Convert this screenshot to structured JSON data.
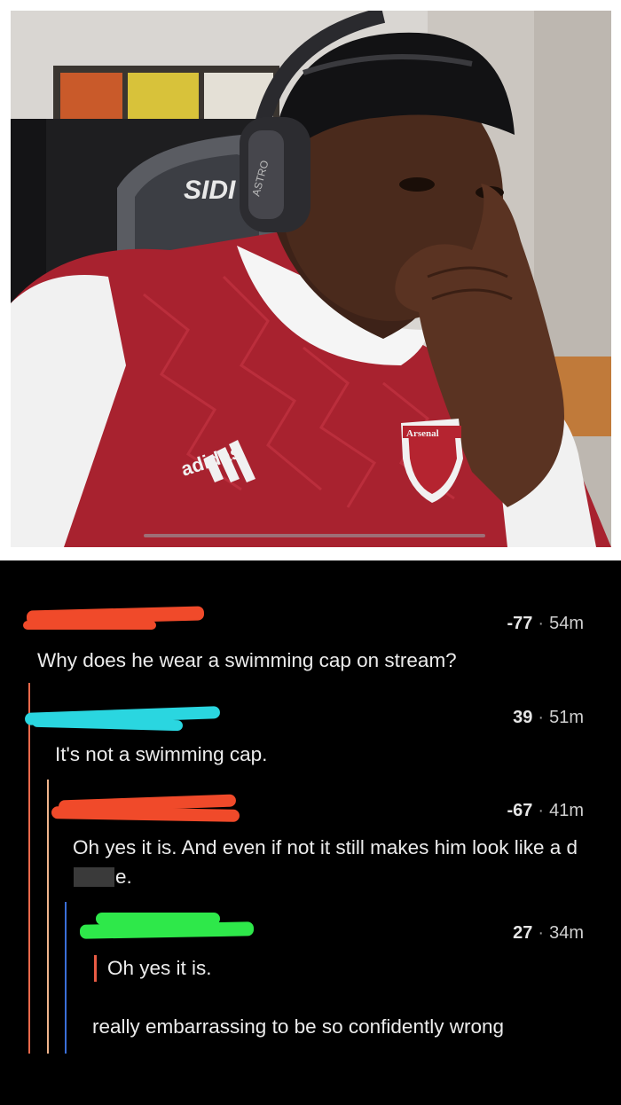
{
  "photo": {
    "shirt_brand": "adidas",
    "shirt_club": "Arsenal",
    "chair_brand": "SIDI",
    "headset_brand": "ASTRO"
  },
  "comments": [
    {
      "score": "-77",
      "age": "54m",
      "text": "Why does he wear a swimming cap on stream?",
      "username_redaction_color": "#f04a2a"
    },
    {
      "score": "39",
      "age": "51m",
      "text": "It's not a swimming cap.",
      "username_redaction_color": "#2ad6e0"
    },
    {
      "score": "-67",
      "age": "41m",
      "text_part1": "Oh yes it is. And even if not it still makes him look like a d",
      "text_part2": "e.",
      "username_redaction_color": "#f04a2a"
    },
    {
      "score": "27",
      "age": "34m",
      "quote": "Oh yes it is.",
      "text": "really embarrassing to be so confidently wrong",
      "username_redaction_color": "#2ee84a"
    }
  ],
  "separator": "·",
  "colors": {
    "background": "#000000",
    "thread_orange": "#e8684a",
    "thread_peach": "#f0b48c",
    "thread_blue": "#3a6fd8"
  }
}
